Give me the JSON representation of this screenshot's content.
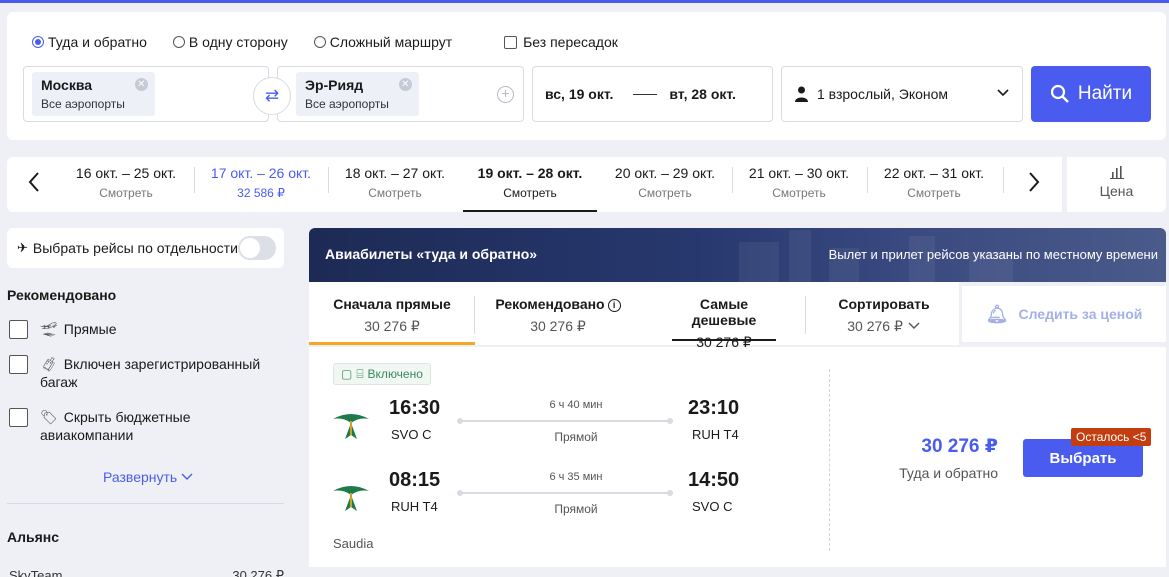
{
  "search": {
    "trip_options": [
      "Туда и обратно",
      "В одну сторону",
      "Сложный маршрут"
    ],
    "selected_trip": 0,
    "nonstop_label": "Без пересадок",
    "origin": {
      "city": "Москва",
      "airports": "Все аэропорты"
    },
    "destination": {
      "city": "Эр-Рияд",
      "airports": "Все аэропорты"
    },
    "depart_date": "вс, 19 окт.",
    "return_date": "вт, 28 окт.",
    "passengers": "1 взрослый, Эконом",
    "find_label": "Найти"
  },
  "date_strip": {
    "cells": [
      {
        "range": "16 окт. – 25 окт.",
        "value": "Смотреть"
      },
      {
        "range": "17 окт. – 26 окт.",
        "value": "32 586 ₽"
      },
      {
        "range": "18 окт. – 27 окт.",
        "value": "Смотреть"
      },
      {
        "range": "19 окт. – 28 окт.",
        "value": "Смотреть"
      },
      {
        "range": "20 окт. – 29 окт.",
        "value": "Смотреть"
      },
      {
        "range": "21 окт. – 30 окт.",
        "value": "Смотреть"
      },
      {
        "range": "22 окт. – 31 окт.",
        "value": "Смотреть"
      }
    ],
    "price_tab_label": "Цена"
  },
  "sidebar": {
    "toggle_label": "Выбрать рейсы по отдельности",
    "recommended_title": "Рекомендовано",
    "filters": [
      "Прямые",
      "Включен зарегистрированный багаж",
      "Скрыть бюджетные авиакомпании"
    ],
    "expand_label": "Развернуть",
    "alliance_title": "Альянс",
    "alliance_item": {
      "name": "SkyTeam",
      "price": "30 276 ₽"
    }
  },
  "results": {
    "title": "Авиабилеты «туда и обратно»",
    "note": "Вылет и прилет рейсов указаны по местному времени",
    "sort_tabs": [
      {
        "title": "Сначала прямые",
        "price": "30 276 ₽"
      },
      {
        "title": "Рекомендовано",
        "price": "30 276 ₽"
      },
      {
        "title": "Самые дешевые",
        "price": "30 276 ₽"
      },
      {
        "title": "Сортировать",
        "price": "30 276 ₽"
      }
    ],
    "track_price_label": "Следить за ценой"
  },
  "flight": {
    "baggage_label": "Включено",
    "segments": [
      {
        "dep_time": "16:30",
        "dep_airport": "SVO C",
        "duration": "6 ч 40 мин",
        "stops": "Прямой",
        "arr_time": "23:10",
        "arr_airport": "RUH T4"
      },
      {
        "dep_time": "08:15",
        "dep_airport": "RUH T4",
        "duration": "6 ч 35 мин",
        "stops": "Прямой",
        "arr_time": "14:50",
        "arr_airport": "SVO C"
      }
    ],
    "carrier": "Saudia",
    "price": "30 276 ₽",
    "price_note": "Туда и обратно",
    "choose_label": "Выбрать",
    "seats_left": "Осталось <5"
  },
  "colors": {
    "accent": "#4a5cf0",
    "banner": "#1d2a55",
    "badge_red": "#c23e10",
    "baggage_green": "#3a8a5e",
    "sort_active": "#f5a623"
  }
}
